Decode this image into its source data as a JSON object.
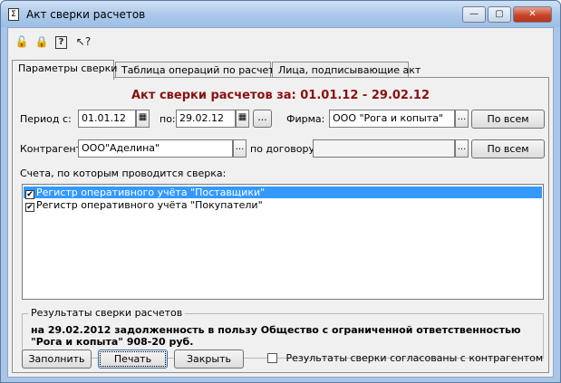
{
  "window": {
    "title": "Акт сверки расчетов",
    "icon_label": "Σ",
    "controls": {
      "minimize": "—",
      "maximize": "▢",
      "close": "✕"
    }
  },
  "toolbar": {
    "icons": [
      "lock-open-icon",
      "lock-closed-icon",
      "help-icon",
      "whats-this-icon"
    ],
    "glyphs": [
      "🔓",
      "🔒",
      "?",
      "↖?"
    ]
  },
  "tabs": [
    {
      "label": "Параметры сверки",
      "active": true
    },
    {
      "label": "Таблица операций по расчетам",
      "active": false
    },
    {
      "label": "Лица, подписывающие акт",
      "active": false
    }
  ],
  "form": {
    "heading": "Акт сверки расчетов за: 01.01.12 - 29.02.12",
    "period_label": "Период с:",
    "period_from": "01.01.12",
    "period_to_label": "по:",
    "period_to": "29.02.12",
    "ellipsis": "...",
    "calendar_glyph": "▦",
    "firm_label": "Фирма:",
    "firm_value": "ООО \"Рога и копыта\"",
    "all_button": "По всем",
    "counterparty_label": "Контрагент:",
    "counterparty_value": "ООО\"Аделина\"",
    "contract_label": "по договору:",
    "contract_value": "",
    "accounts_label": "Счета, по которым проводится сверка:",
    "accounts": [
      {
        "label": "Регистр оперативного учёта \"Поставщики\"",
        "checked": true,
        "selected": true
      },
      {
        "label": "Регистр оперативного учёта \"Покупатели\"",
        "checked": true,
        "selected": false
      }
    ],
    "check_glyph": "✔"
  },
  "results": {
    "title": "Результаты сверки расчетов",
    "text": "на 29.02.2012 задолженность в пользу Общество с ограниченной ответственностью \"Рога и копыта\" 908-20 руб."
  },
  "footer": {
    "fill_button": "Заполнить",
    "print_button": "Печать",
    "close_button": "Закрыть",
    "agreed_label": "Результаты сверки согласованы с контрагентом",
    "agreed_checked": false
  }
}
